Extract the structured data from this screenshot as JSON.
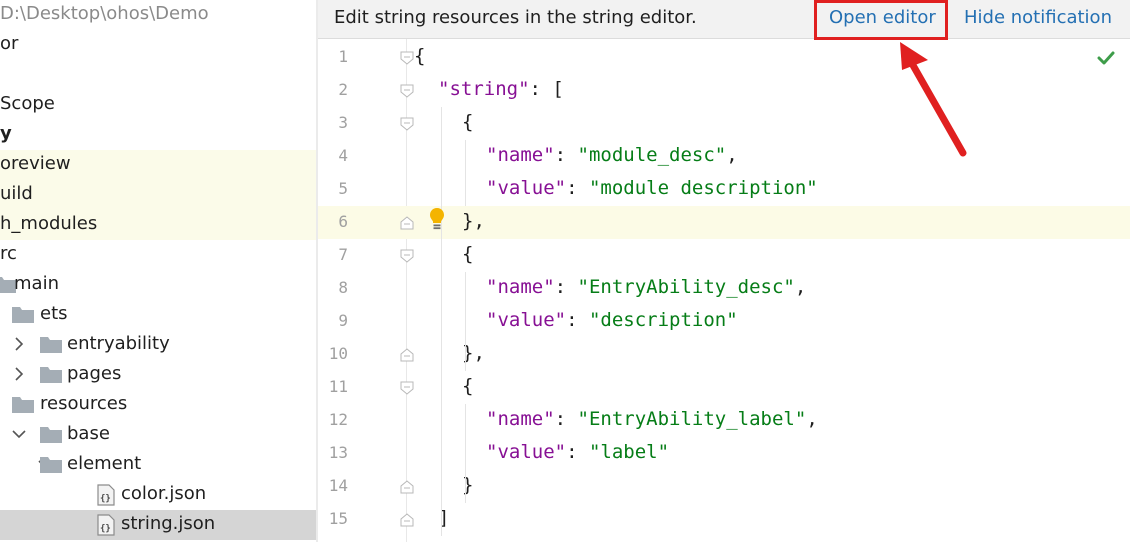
{
  "tree": {
    "rows": [
      {
        "label": "D:\\Desktop\\ohos\\Demo",
        "indent": 0,
        "type": "path",
        "muted": true
      },
      {
        "label": "or",
        "indent": 0,
        "type": "text"
      },
      {
        "label": "",
        "indent": 0,
        "type": "text"
      },
      {
        "label": "Scope",
        "indent": 0,
        "type": "text"
      },
      {
        "label": "y",
        "indent": 0,
        "type": "bold"
      },
      {
        "label": "oreview",
        "indent": 0,
        "type": "text",
        "highlight": true
      },
      {
        "label": "uild",
        "indent": 0,
        "type": "text",
        "highlight": true
      },
      {
        "label": "h_modules",
        "indent": 0,
        "type": "text",
        "highlight": true
      },
      {
        "label": "rc",
        "indent": 0,
        "type": "text"
      },
      {
        "label": "main",
        "indent": 1,
        "type": "folder"
      },
      {
        "label": "ets",
        "indent": 2,
        "type": "folder"
      },
      {
        "label": "entryability",
        "indent": 3,
        "type": "folder",
        "chevron": "right"
      },
      {
        "label": "pages",
        "indent": 3,
        "type": "folder",
        "chevron": "right"
      },
      {
        "label": "resources",
        "indent": 2,
        "type": "folder"
      },
      {
        "label": "base",
        "indent": 3,
        "type": "folder",
        "chevron": "down"
      },
      {
        "label": "element",
        "indent": 4,
        "type": "folder",
        "chevron": "down"
      },
      {
        "label": "color.json",
        "indent": 5,
        "type": "file"
      },
      {
        "label": "string.json",
        "indent": 5,
        "type": "file",
        "selected": true
      }
    ]
  },
  "notification": {
    "text": "Edit string resources in the string editor.",
    "open_editor": "Open editor",
    "hide_notification": "Hide notification"
  },
  "editor": {
    "current_line": 6,
    "lines": [
      {
        "n": "1",
        "fold": "open",
        "indent": 0,
        "tokens": [
          {
            "t": "p",
            "v": "{"
          }
        ]
      },
      {
        "n": "2",
        "fold": "open",
        "indent": 1,
        "tokens": [
          {
            "t": "k",
            "v": "\"string\""
          },
          {
            "t": "p",
            "v": ": ["
          }
        ]
      },
      {
        "n": "3",
        "fold": "open",
        "indent": 2,
        "tokens": [
          {
            "t": "p",
            "v": "{"
          }
        ]
      },
      {
        "n": "4",
        "fold": "",
        "indent": 3,
        "tokens": [
          {
            "t": "k",
            "v": "\"name\""
          },
          {
            "t": "p",
            "v": ": "
          },
          {
            "t": "s",
            "v": "\"module_desc\""
          },
          {
            "t": "p",
            "v": ","
          }
        ]
      },
      {
        "n": "5",
        "fold": "",
        "indent": 3,
        "tokens": [
          {
            "t": "k",
            "v": "\"value\""
          },
          {
            "t": "p",
            "v": ": "
          },
          {
            "t": "s",
            "v": "\"module description\""
          }
        ]
      },
      {
        "n": "6",
        "fold": "close",
        "indent": 2,
        "tokens": [
          {
            "t": "p",
            "v": "},"
          }
        ]
      },
      {
        "n": "7",
        "fold": "open",
        "indent": 2,
        "tokens": [
          {
            "t": "p",
            "v": "{"
          }
        ]
      },
      {
        "n": "8",
        "fold": "",
        "indent": 3,
        "tokens": [
          {
            "t": "k",
            "v": "\"name\""
          },
          {
            "t": "p",
            "v": ": "
          },
          {
            "t": "s",
            "v": "\"EntryAbility_desc\""
          },
          {
            "t": "p",
            "v": ","
          }
        ]
      },
      {
        "n": "9",
        "fold": "",
        "indent": 3,
        "tokens": [
          {
            "t": "k",
            "v": "\"value\""
          },
          {
            "t": "p",
            "v": ": "
          },
          {
            "t": "s",
            "v": "\"description\""
          }
        ]
      },
      {
        "n": "10",
        "fold": "close",
        "indent": 2,
        "tokens": [
          {
            "t": "p",
            "v": "},"
          }
        ]
      },
      {
        "n": "11",
        "fold": "open",
        "indent": 2,
        "tokens": [
          {
            "t": "p",
            "v": "{"
          }
        ]
      },
      {
        "n": "12",
        "fold": "",
        "indent": 3,
        "tokens": [
          {
            "t": "k",
            "v": "\"name\""
          },
          {
            "t": "p",
            "v": ": "
          },
          {
            "t": "s",
            "v": "\"EntryAbility_label\""
          },
          {
            "t": "p",
            "v": ","
          }
        ]
      },
      {
        "n": "13",
        "fold": "",
        "indent": 3,
        "tokens": [
          {
            "t": "k",
            "v": "\"value\""
          },
          {
            "t": "p",
            "v": ": "
          },
          {
            "t": "s",
            "v": "\"label\""
          }
        ]
      },
      {
        "n": "14",
        "fold": "close",
        "indent": 2,
        "tokens": [
          {
            "t": "p",
            "v": "}"
          }
        ]
      },
      {
        "n": "15",
        "fold": "close",
        "indent": 1,
        "tokens": [
          {
            "t": "p",
            "v": "]"
          }
        ]
      }
    ]
  },
  "icons": {
    "inspection_ok": "check-icon",
    "intention": "lightbulb-icon",
    "annotation": "red-arrow"
  },
  "colors": {
    "key": "#871094",
    "string": "#067d17",
    "link": "#2470b3",
    "highlight_box": "#e02020",
    "check": "#3e9d4a"
  }
}
